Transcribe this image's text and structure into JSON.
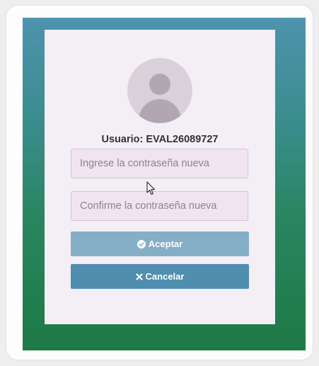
{
  "user": {
    "label": "Usuario: EVAL26089727"
  },
  "fields": {
    "new_password_placeholder": "Ingrese la contraseña nueva",
    "confirm_password_placeholder": "Confirme la contraseña nueva"
  },
  "buttons": {
    "accept_label": "Aceptar",
    "accept_icon": "check-circle-icon",
    "cancel_label": "Cancelar",
    "cancel_icon": "close-icon"
  },
  "colors": {
    "background_top": "#4e93ad",
    "background_bottom": "#1d7a45",
    "card": "#f4eef5",
    "accept_button": "#85afc7",
    "cancel_button": "#4f8eae"
  }
}
